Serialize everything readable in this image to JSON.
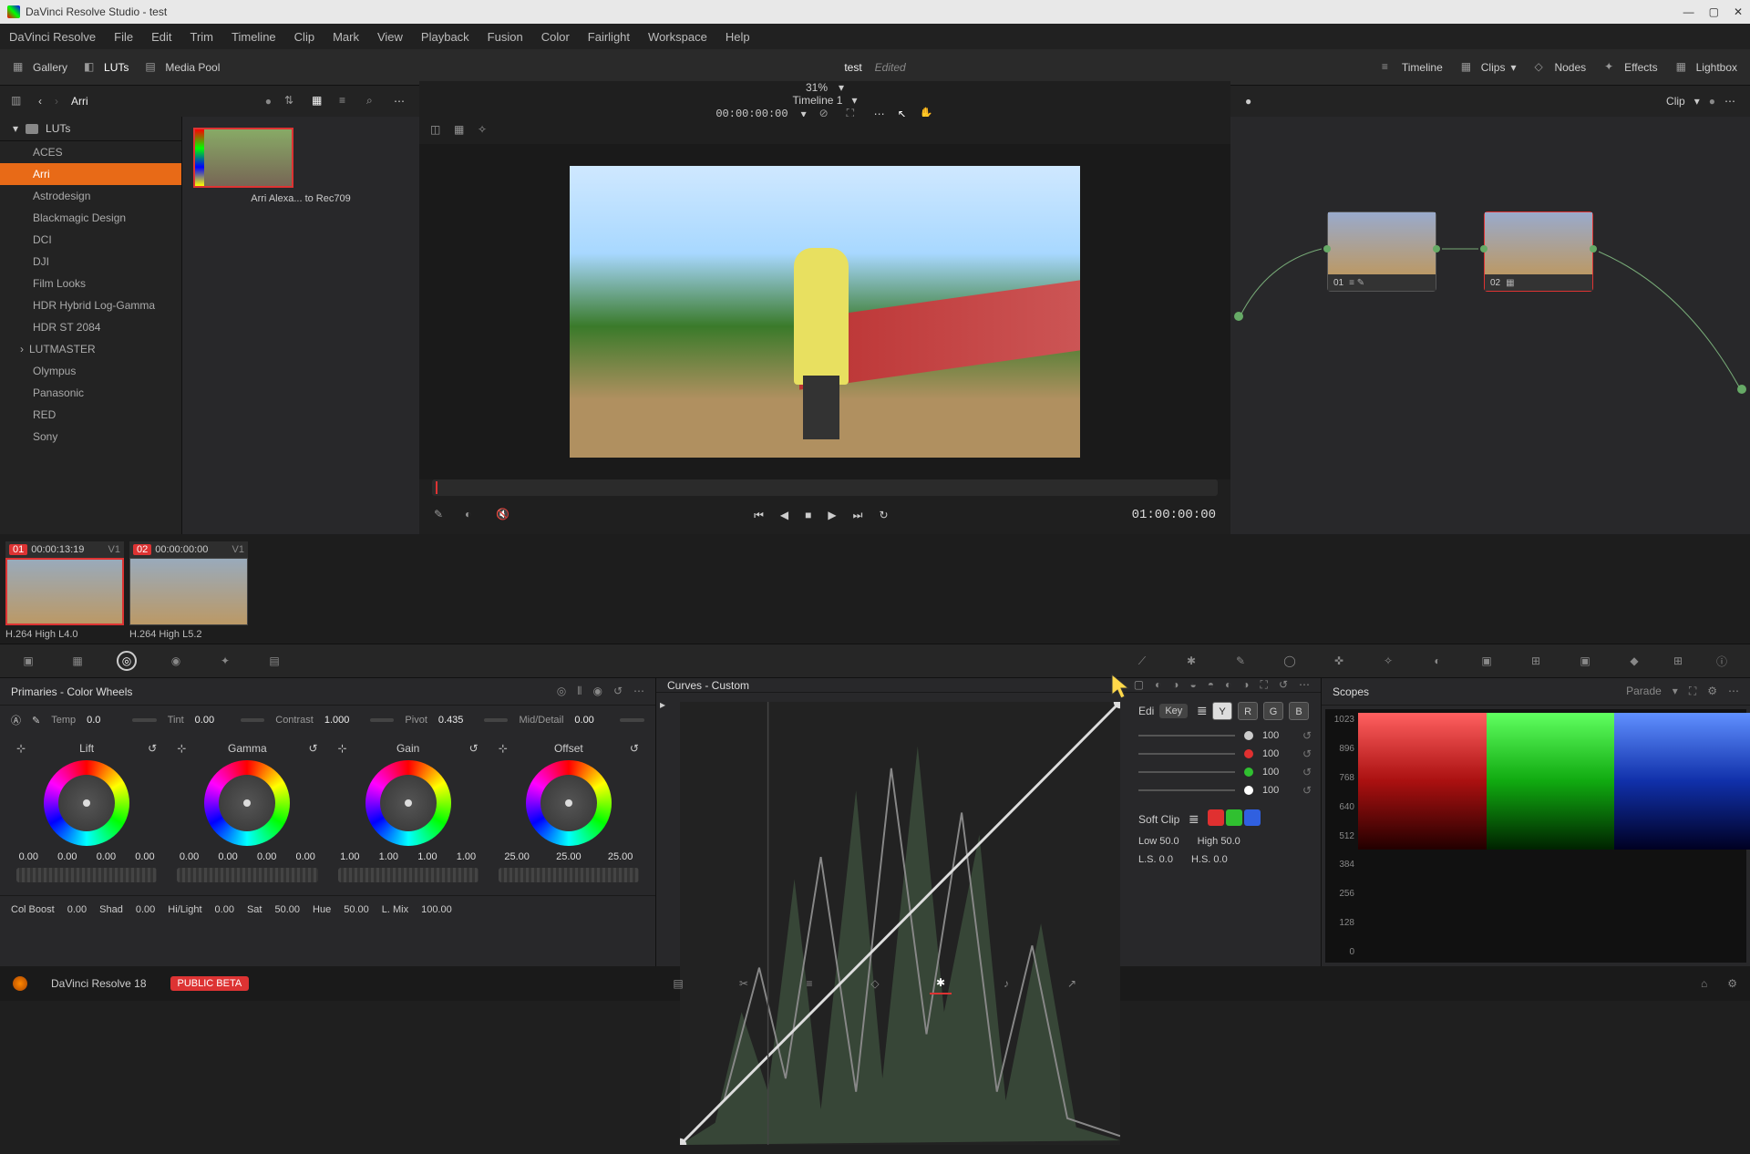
{
  "app": {
    "title": "DaVinci Resolve Studio - test"
  },
  "menu": [
    "DaVinci Resolve",
    "File",
    "Edit",
    "Trim",
    "Timeline",
    "Clip",
    "Mark",
    "View",
    "Playback",
    "Fusion",
    "Color",
    "Fairlight",
    "Workspace",
    "Help"
  ],
  "toolbar": {
    "gallery": "Gallery",
    "luts": "LUTs",
    "mediapool": "Media Pool",
    "project": "test",
    "edited": "Edited",
    "timeline": "Timeline",
    "clips": "Clips",
    "nodes": "Nodes",
    "effects": "Effects",
    "lightbox": "Lightbox"
  },
  "browser": {
    "current": "Arri",
    "zoom": "31%",
    "timeline": "Timeline 1",
    "tc": "00:00:00:00",
    "node_tab": "Clip"
  },
  "luts_tree": {
    "root": "LUTs",
    "items": [
      "ACES",
      "Arri",
      "Astrodesign",
      "Blackmagic Design",
      "DCI",
      "DJI",
      "Film Looks",
      "HDR Hybrid Log-Gamma",
      "HDR ST 2084",
      "LUTMASTER",
      "Olympus",
      "Panasonic",
      "RED",
      "Sony"
    ],
    "selected": 1,
    "expandable": [
      9
    ]
  },
  "lut_thumb": {
    "label": "Arri Alexa... to Rec709"
  },
  "viewer": {
    "tc": "01:00:00:00"
  },
  "nodes": [
    {
      "id": "01",
      "icons": "≡ ✎"
    },
    {
      "id": "02",
      "icons": "▦"
    }
  ],
  "clips": [
    {
      "num": "01",
      "tc": "00:00:13:19",
      "track": "V1",
      "name": "H.264 High L4.0",
      "sel": true
    },
    {
      "num": "02",
      "tc": "00:00:00:00",
      "track": "V1",
      "name": "H.264 High L5.2",
      "sel": false
    }
  ],
  "primaries": {
    "title": "Primaries - Color Wheels",
    "temp_lbl": "Temp",
    "temp": "0.0",
    "tint_lbl": "Tint",
    "tint": "0.00",
    "contrast_lbl": "Contrast",
    "contrast": "1.000",
    "pivot_lbl": "Pivot",
    "pivot": "0.435",
    "md_lbl": "Mid/Detail",
    "md": "0.00",
    "wheels": [
      {
        "name": "Lift",
        "vals": [
          "0.00",
          "0.00",
          "0.00",
          "0.00"
        ]
      },
      {
        "name": "Gamma",
        "vals": [
          "0.00",
          "0.00",
          "0.00",
          "0.00"
        ]
      },
      {
        "name": "Gain",
        "vals": [
          "1.00",
          "1.00",
          "1.00",
          "1.00"
        ]
      },
      {
        "name": "Offset",
        "vals": [
          "25.00",
          "25.00",
          "25.00"
        ]
      }
    ],
    "bottom": {
      "colboost_lbl": "Col Boost",
      "colboost": "0.00",
      "shad_lbl": "Shad",
      "shad": "0.00",
      "hilight_lbl": "Hi/Light",
      "hilight": "0.00",
      "sat_lbl": "Sat",
      "sat": "50.00",
      "hue_lbl": "Hue",
      "hue": "50.00",
      "lmix_lbl": "L. Mix",
      "lmix": "100.00"
    }
  },
  "curves": {
    "title": "Curves - Custom",
    "edit_lbl": "Edi",
    "tooltip": "Key",
    "channels": [
      "Y",
      "R",
      "G",
      "B"
    ],
    "intensities": [
      {
        "color": "#cccccc",
        "val": "100"
      },
      {
        "color": "#e03030",
        "val": "100"
      },
      {
        "color": "#30c030",
        "val": "100"
      },
      {
        "color": "#ffffff",
        "val": "100"
      }
    ],
    "softclip_lbl": "Soft Clip",
    "softclip_colors": [
      "#e03030",
      "#30c030",
      "#3060e0"
    ],
    "low_lbl": "Low",
    "low": "50.0",
    "high_lbl": "High",
    "high": "50.0",
    "ls_lbl": "L.S.",
    "ls": "0.0",
    "hs_lbl": "H.S.",
    "hs": "0.0"
  },
  "scopes": {
    "title": "Scopes",
    "mode": "Parade",
    "ticks": [
      "1023",
      "896",
      "768",
      "640",
      "512",
      "384",
      "256",
      "128",
      "0"
    ]
  },
  "footer": {
    "app": "DaVinci Resolve 18",
    "badge": "PUBLIC BETA"
  }
}
